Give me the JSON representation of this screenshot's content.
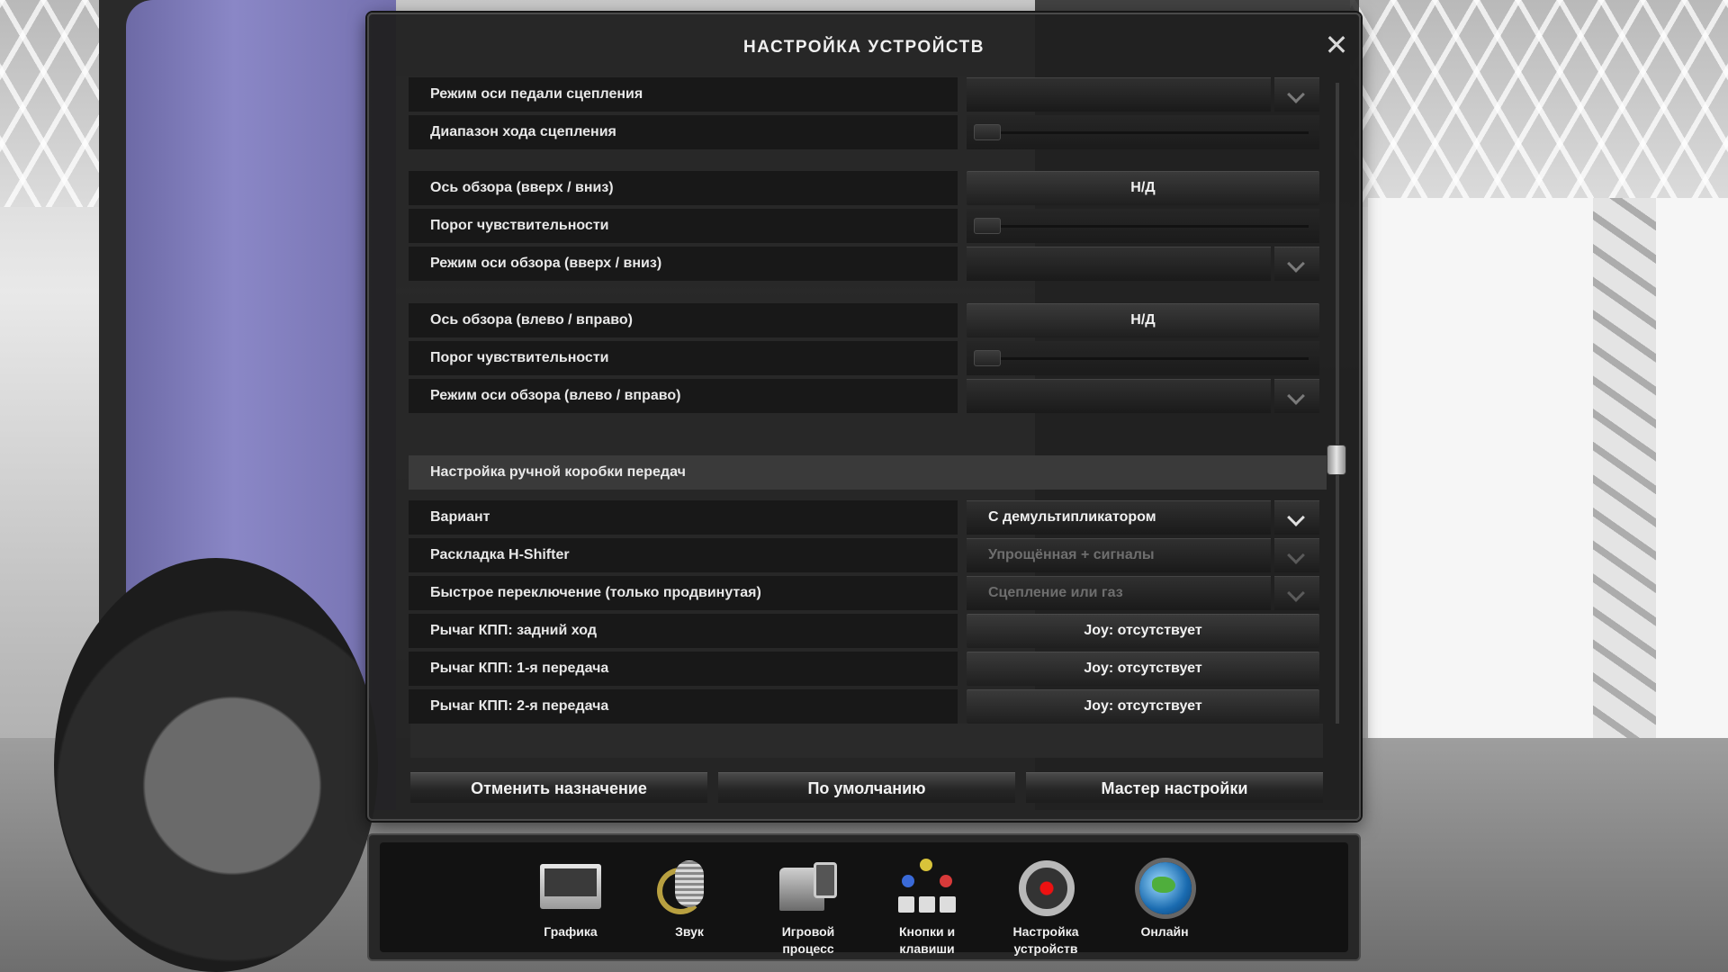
{
  "dialog": {
    "title": "НАСТРОЙКА УСТРОЙСТВ",
    "close_symbol": "✕"
  },
  "rows": [
    {
      "label": "Режим оси педали сцепления",
      "control": "dropdown",
      "value": ""
    },
    {
      "label": "Диапазон хода сцепления",
      "control": "slider",
      "level": 0
    },
    {
      "label": "Ось обзора (вверх / вниз)",
      "control": "button",
      "value": "Н/Д"
    },
    {
      "label": "Порог чувствительности",
      "control": "slider",
      "level": 0
    },
    {
      "label": "Режим оси обзора (вверх / вниз)",
      "control": "dropdown",
      "value": ""
    },
    {
      "label": "Ось обзора (влево / вправо)",
      "control": "button",
      "value": "Н/Д"
    },
    {
      "label": "Порог чувствительности",
      "control": "slider",
      "level": 0
    },
    {
      "label": "Режим оси обзора (влево / вправо)",
      "control": "dropdown",
      "value": ""
    }
  ],
  "section": {
    "title": "Настройка ручной коробки передач",
    "rows": [
      {
        "label": "Вариант",
        "control": "dropdown",
        "value": "С демультипликатором",
        "disabled": false
      },
      {
        "label": "Раскладка H-Shifter",
        "control": "dropdown",
        "value": "Упрощённая + сигналы",
        "disabled": true
      },
      {
        "label": "Быстрое переключение (только продвинутая)",
        "control": "dropdown",
        "value": "Сцепление или газ",
        "disabled": true
      },
      {
        "label": "Рычаг КПП: задний ход",
        "control": "button",
        "value": "Joy: отсутствует"
      },
      {
        "label": "Рычаг КПП: 1-я передача",
        "control": "button",
        "value": "Joy: отсутствует"
      },
      {
        "label": "Рычаг КПП: 2-я передача",
        "control": "button",
        "value": "Joy: отсутствует"
      }
    ]
  },
  "buttons": {
    "unassign": "Отменить назначение",
    "defaults": "По умолчанию",
    "wizard": "Мастер настройки"
  },
  "menu": [
    {
      "label": "Графика",
      "icon": "monitor-icon"
    },
    {
      "label": "Звук",
      "icon": "microphone-icon"
    },
    {
      "label": "Игровой процесс",
      "icon": "truck-phone-icon"
    },
    {
      "label": "Кнопки и клавиши",
      "icon": "gamepad-keys-icon"
    },
    {
      "label": "Настройка устройств",
      "icon": "steering-wheel-icon"
    },
    {
      "label": "Онлайн",
      "icon": "globe-icon"
    }
  ],
  "colors": {
    "panel": "#202020",
    "row": "#181818",
    "section": "#3a3a3a",
    "text": "#e8e8e8",
    "disabled_text": "#6e6e6e"
  }
}
